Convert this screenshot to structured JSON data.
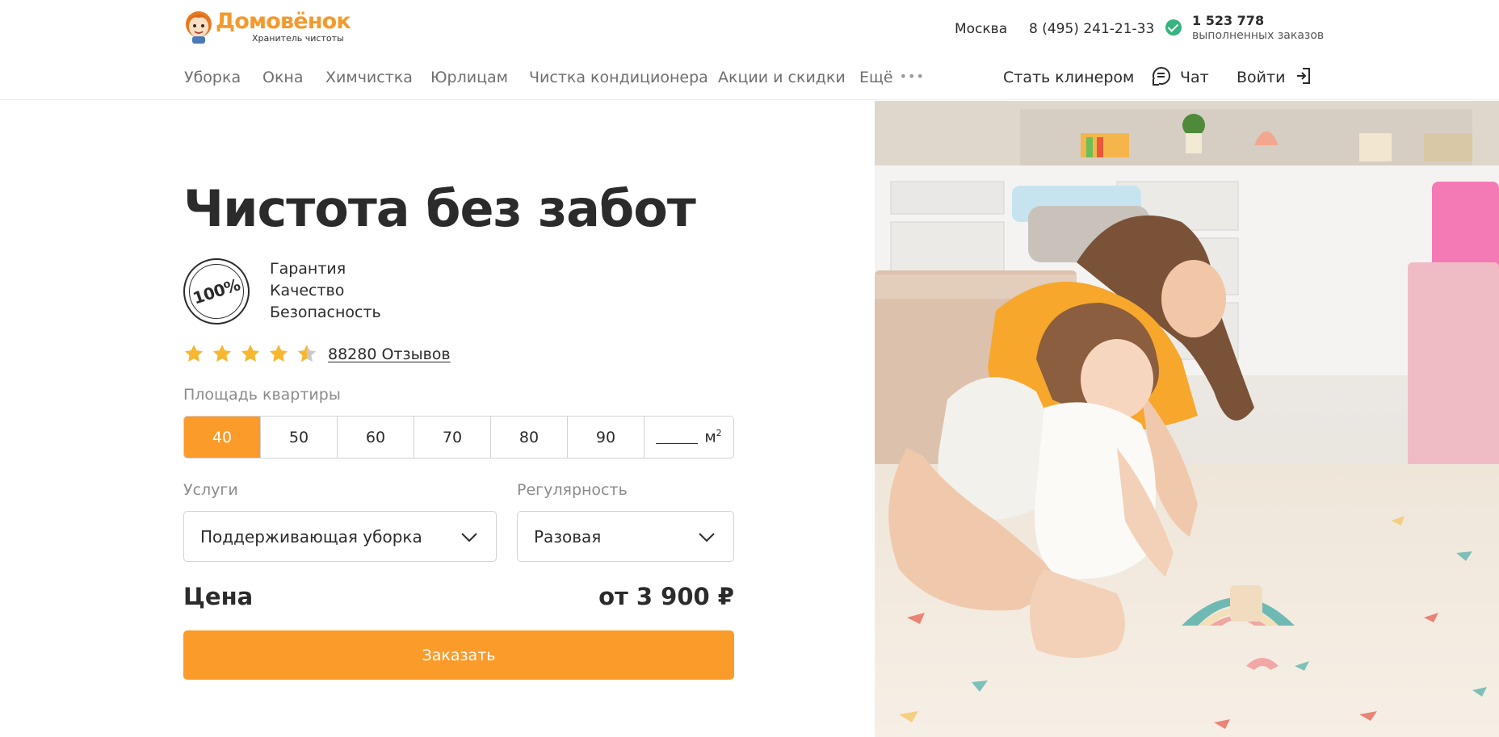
{
  "header": {
    "logo_name": "Домовёнок",
    "logo_tagline": "Хранитель чистоты",
    "city": "Москва",
    "phone": "8 (495) 241-21-33",
    "orders_count": "1 523 778",
    "orders_label": "выполненных заказов"
  },
  "nav": {
    "items": [
      "Уборка",
      "Окна",
      "Химчистка",
      "Юрлицам",
      "Чистка кондиционера",
      "Акции и скидки",
      "Ещё"
    ],
    "more_dots": "•••",
    "become_cleaner": "Стать клинером",
    "chat": "Чат",
    "login": "Войти"
  },
  "hero": {
    "title": "Чистота без забот",
    "badge": "100%",
    "guarantees": [
      "Гарантия",
      "Качество",
      "Безопасность"
    ],
    "rating": 4.5,
    "reviews": "88280 Отзывов"
  },
  "calculator": {
    "area_label": "Площадь квартиры",
    "area_options": [
      "40",
      "50",
      "60",
      "70",
      "80",
      "90"
    ],
    "area_selected": "40",
    "area_unit": "м",
    "area_unit_power": "2",
    "services_label": "Услуги",
    "services_value": "Поддерживающая уборка",
    "regularity_label": "Регулярность",
    "regularity_value": "Разовая",
    "price_label": "Цена",
    "price_value": "от 3 900 ₽",
    "order_button": "Заказать"
  },
  "colors": {
    "brand_orange": "#fb9b2a",
    "logo_orange": "#f39a2e",
    "star_yellow": "#f7b731",
    "check_green": "#36b37e"
  }
}
